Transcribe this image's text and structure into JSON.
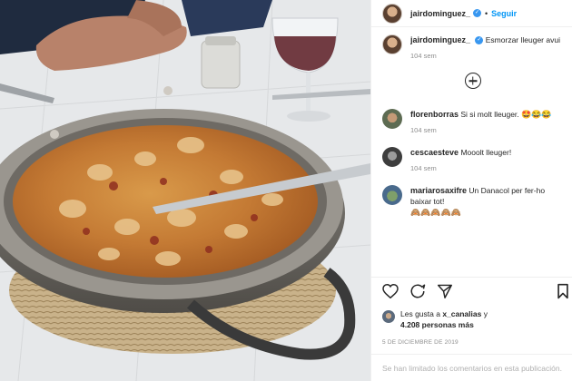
{
  "post": {
    "author": "jairdominguez_",
    "follow_label": "Seguir",
    "separator": "•",
    "caption": "Esmorzar lleuger avui",
    "caption_time": "104 sem"
  },
  "comments": [
    {
      "user": "florenborras",
      "text": "Si si molt lleuger.",
      "emoji": "🤩😂😂",
      "time": "104 sem"
    },
    {
      "user": "cescaesteve",
      "text": "Mooolt lleuger!",
      "emoji": "",
      "time": "104 sem"
    },
    {
      "user": "mariarosaxifre",
      "text": "Un Danacol per fer-ho baixar tot!",
      "emoji": "🙈🙈🙈🙈🙈",
      "time": ""
    }
  ],
  "likes": {
    "prefix": "Les gusta a",
    "user": "x_canalias",
    "connector": "y",
    "count": "4.208 personas más"
  },
  "date": "5 DE DICIEMBRE DE 2019",
  "comments_limited": "Se han limitado los comentarios en esta publicación.",
  "icons": [
    "verified-icon",
    "add-comments-icon",
    "heart-icon",
    "comment-icon",
    "share-icon",
    "bookmark-icon"
  ],
  "colors": {
    "accent": "#0095f6",
    "verified": "#3897f0",
    "muted": "#8e8e8e"
  }
}
